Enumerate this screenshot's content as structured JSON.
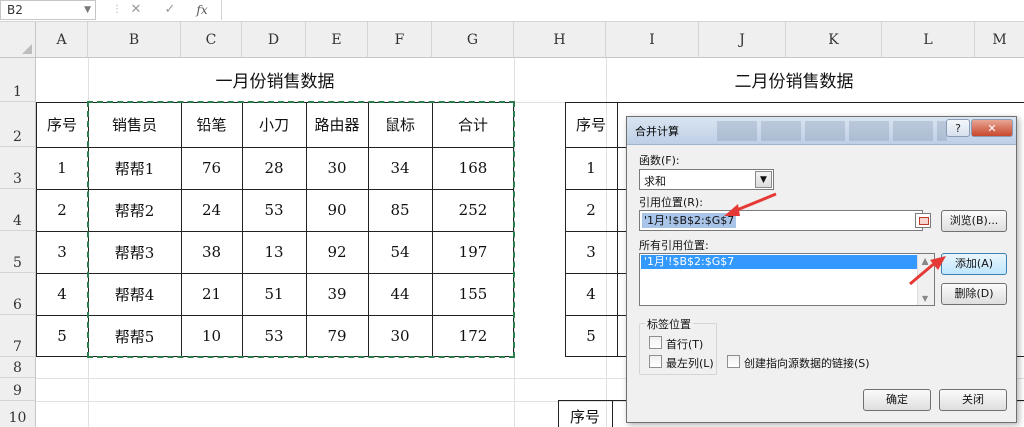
{
  "formula_bar": {
    "name_box": "B2",
    "cancel": "✕",
    "enter": "✓",
    "fx": "fx",
    "value": ""
  },
  "columns": [
    "A",
    "B",
    "C",
    "D",
    "E",
    "F",
    "G",
    "H",
    "I",
    "J",
    "K",
    "L",
    "M"
  ],
  "rows": [
    "1",
    "2",
    "3",
    "4",
    "5",
    "6",
    "7",
    "8",
    "9",
    "10"
  ],
  "table1": {
    "title": "一月份销售数据",
    "headers": [
      "序号",
      "销售员",
      "铅笔",
      "小刀",
      "路由器",
      "鼠标",
      "合计"
    ],
    "rows": [
      [
        "1",
        "帮帮1",
        "76",
        "28",
        "30",
        "34",
        "168"
      ],
      [
        "2",
        "帮帮2",
        "24",
        "53",
        "90",
        "85",
        "252"
      ],
      [
        "3",
        "帮帮3",
        "38",
        "13",
        "92",
        "54",
        "197"
      ],
      [
        "4",
        "帮帮4",
        "21",
        "51",
        "39",
        "44",
        "155"
      ],
      [
        "5",
        "帮帮5",
        "10",
        "53",
        "79",
        "30",
        "172"
      ]
    ]
  },
  "table2": {
    "title": "二月份销售数据",
    "header_first": "序号",
    "numbers": [
      "1",
      "2",
      "3",
      "4",
      "5"
    ]
  },
  "table3": {
    "header_first": "序号"
  },
  "dialog": {
    "title": "合并计算",
    "help": "?",
    "close": "✕",
    "function_label": "函数(F):",
    "function_value": "求和",
    "reference_label": "引用位置(R):",
    "reference_value": "'1月'!$B$2:$G$7",
    "browse_label": "浏览(B)...",
    "all_refs_label": "所有引用位置:",
    "all_refs": [
      "'1月'!$B$2:$G$7"
    ],
    "add_label": "添加(A)",
    "delete_label": "删除(D)",
    "label_group": "标签位置",
    "first_row": "首行(T)",
    "left_column": "最左列(L)",
    "link_source": "创建指向源数据的链接(S)",
    "ok_label": "确定",
    "close_label": "关闭"
  },
  "colors": {
    "marquee": "#2e7d4f",
    "arrow": "#e53935",
    "selection": "#3399ff"
  }
}
